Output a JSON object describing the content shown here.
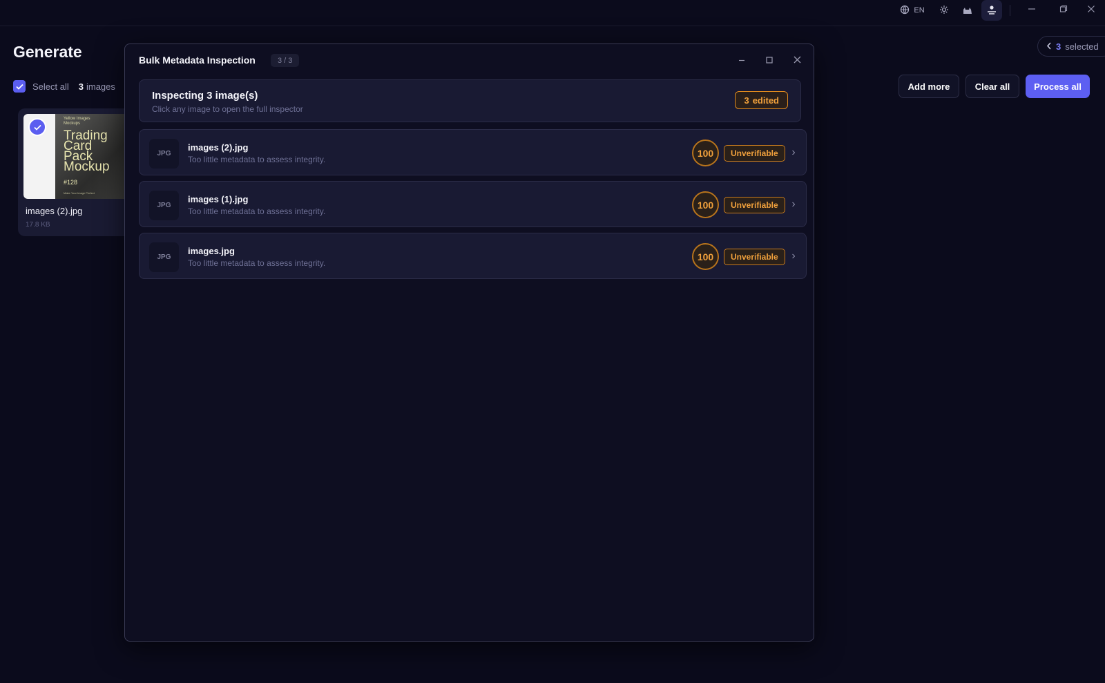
{
  "titlebar": {
    "language": "EN",
    "icons": [
      "globe-icon",
      "sun-icon",
      "cat-icon",
      "user-settings-icon"
    ],
    "window_controls": [
      "minimize-icon",
      "restore-icon",
      "close-icon"
    ]
  },
  "page": {
    "title": "Generate",
    "select_all_label": "Select all",
    "image_count": "3",
    "image_count_label": "images",
    "selected_count": "3",
    "selected_label": "selected",
    "buttons": {
      "add_more": "Add more",
      "clear_all": "Clear all",
      "process_all": "Process all"
    },
    "card": {
      "name": "images (2).jpg",
      "size": "17.8 KB",
      "thumb_small": "Yellow Images\nMockups",
      "thumb_line1": "Trading",
      "thumb_line2": "Card",
      "thumb_line3": "Pack",
      "thumb_line4": "Mockup",
      "thumb_number": "#128"
    }
  },
  "modal": {
    "title": "Bulk Metadata Inspection",
    "counter": "3 / 3",
    "summary_title": "Inspecting 3 image(s)",
    "summary_subtitle": "Click any image to open the full inspector",
    "edited_count": "3",
    "edited_label": "edited",
    "items": [
      {
        "type": "JPG",
        "name": "images (2).jpg",
        "desc": "Too little metadata to assess integrity.",
        "score": "100",
        "status": "Unverifiable"
      },
      {
        "type": "JPG",
        "name": "images (1).jpg",
        "desc": "Too little metadata to assess integrity.",
        "score": "100",
        "status": "Unverifiable"
      },
      {
        "type": "JPG",
        "name": "images.jpg",
        "desc": "Too little metadata to assess integrity.",
        "score": "100",
        "status": "Unverifiable"
      }
    ]
  },
  "colors": {
    "background": "#0b0b1c",
    "accent": "#5d5ff2",
    "warning": "#f0a03c",
    "panel": "#191a33"
  }
}
